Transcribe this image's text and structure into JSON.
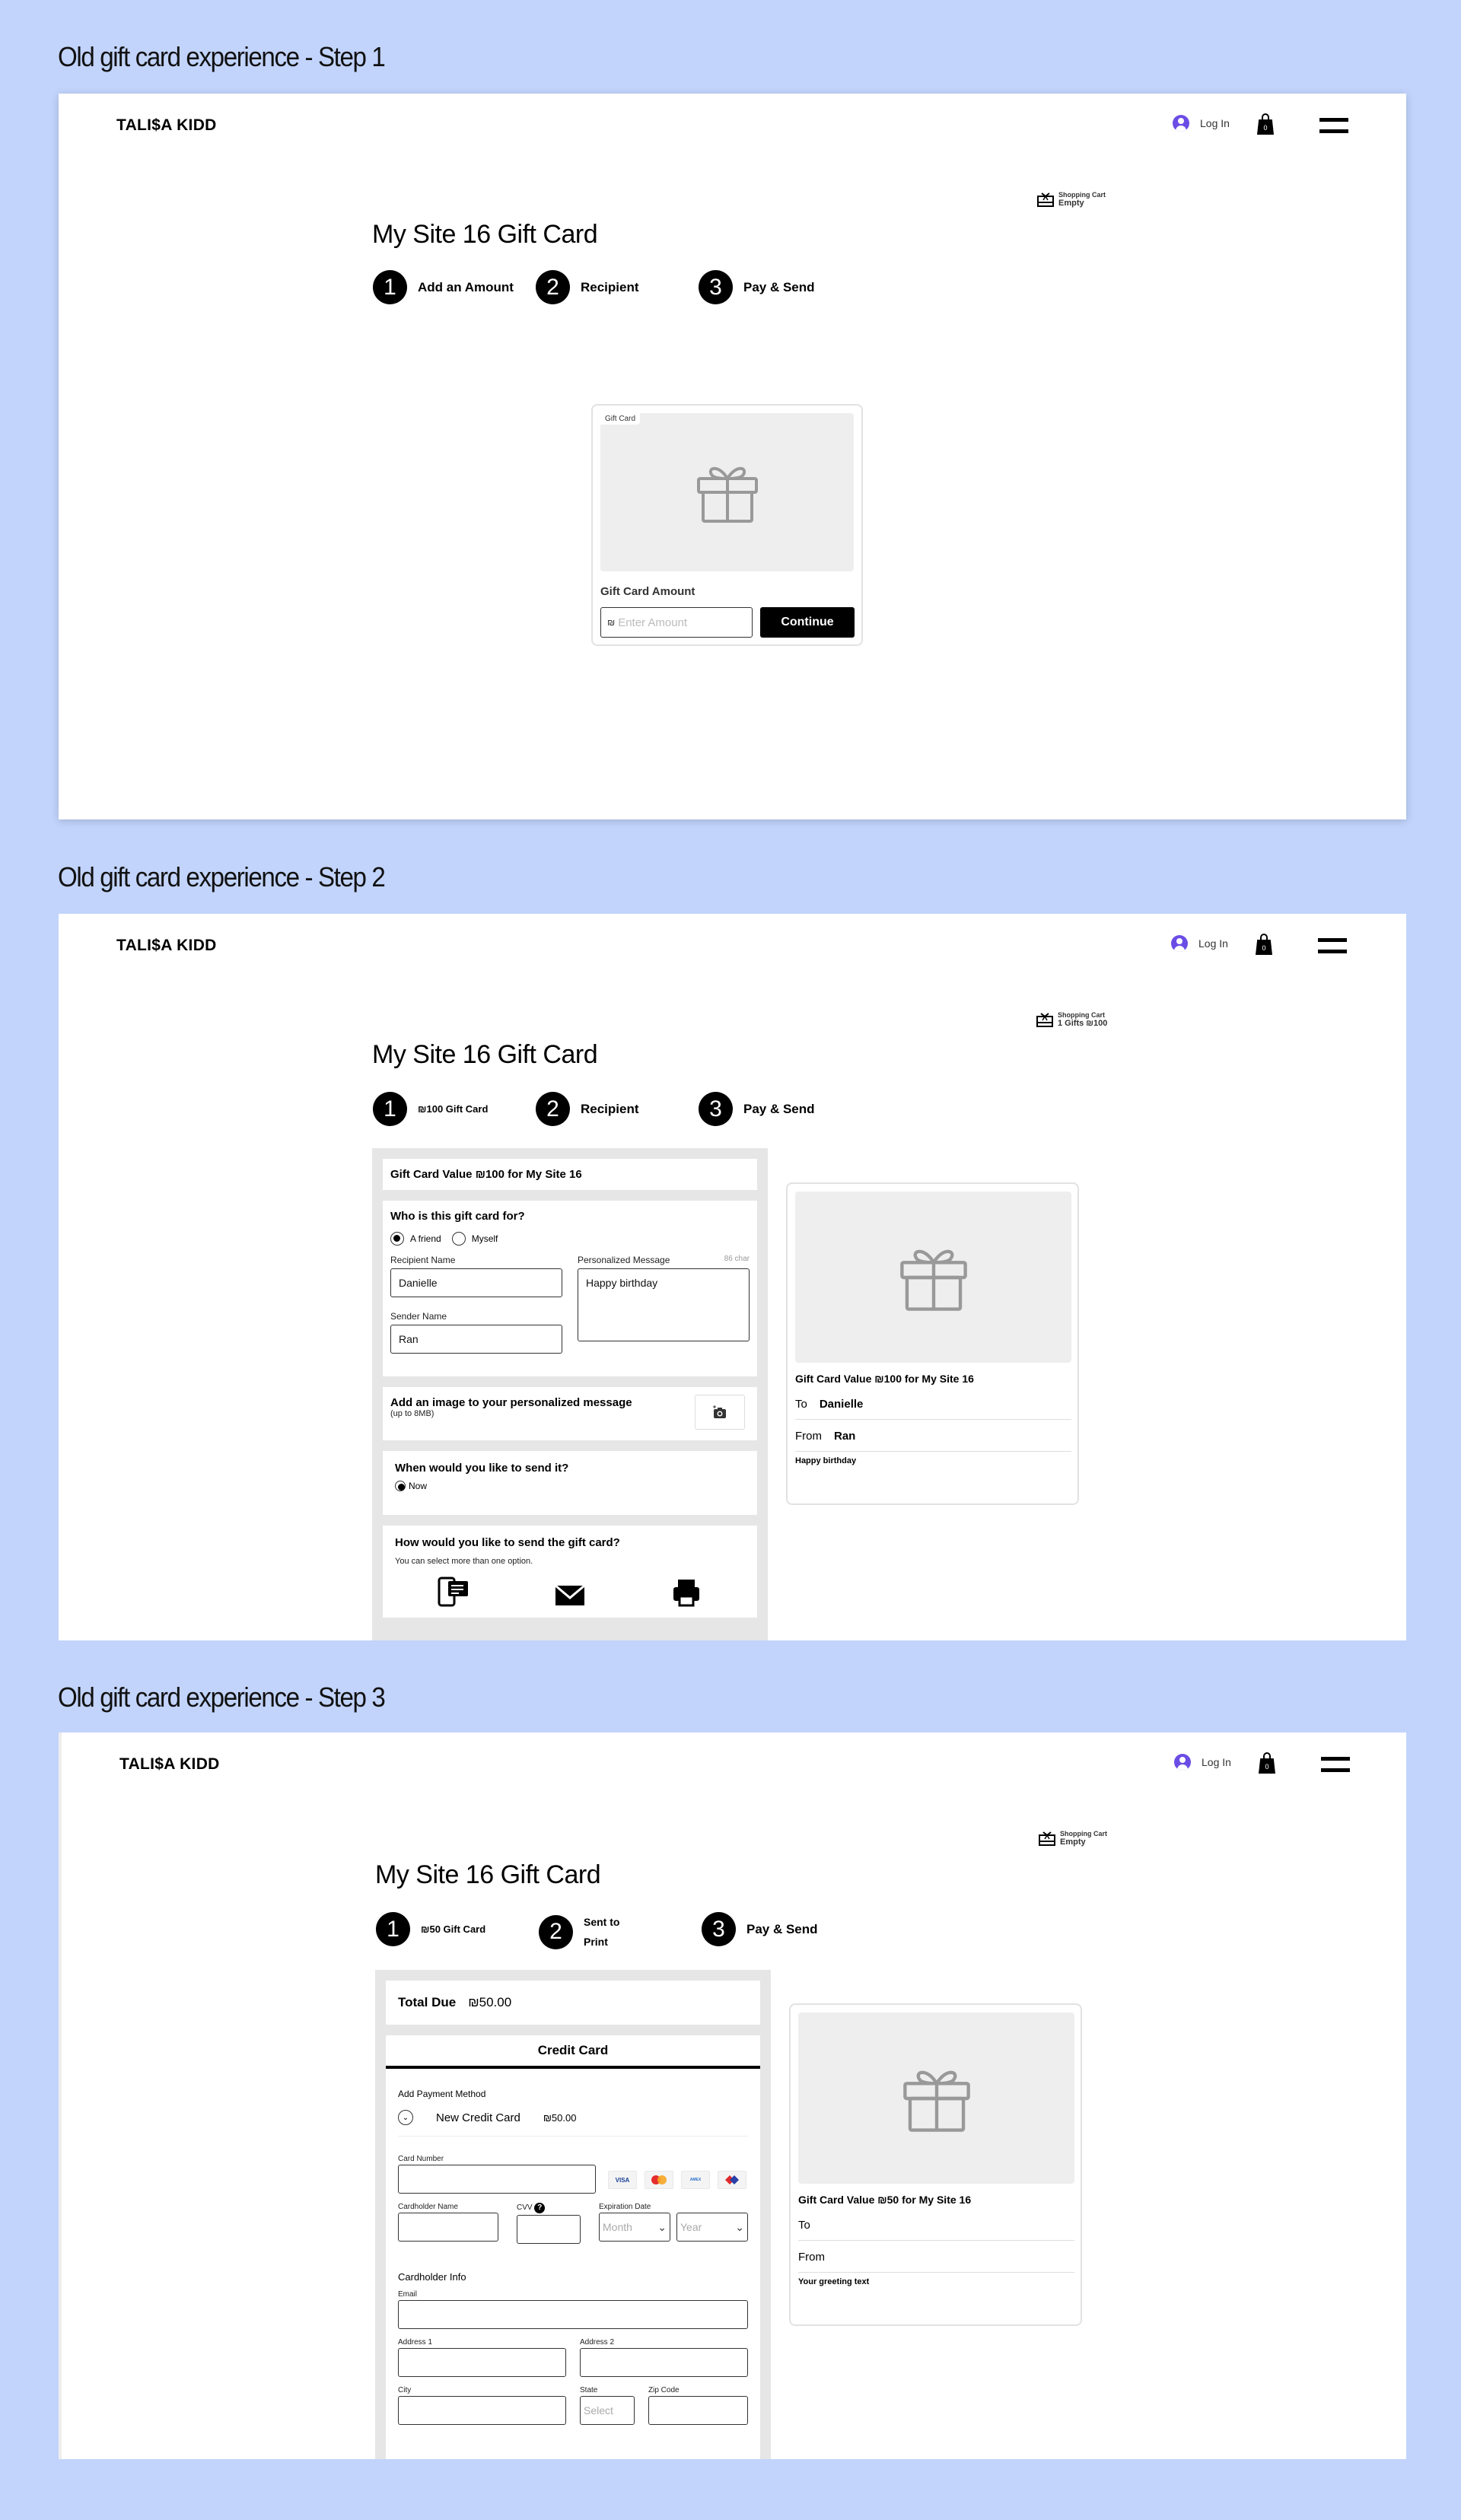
{
  "sections": [
    {
      "title": "Old gift card experience - Step 1",
      "header": {
        "logo": "TALI$A KIDD",
        "login": "Log In",
        "cart_count": "0"
      },
      "mini_cart": {
        "label": "Shopping Cart",
        "status": "Empty"
      },
      "page_title": "My Site 16 Gift Card",
      "steps": [
        {
          "num": "1",
          "label": "Add an Amount"
        },
        {
          "num": "2",
          "label": "Recipient"
        },
        {
          "num": "3",
          "label": "Pay & Send"
        }
      ],
      "gift_card": {
        "tag": "Gift Card",
        "amount_label": "Gift Card Amount",
        "currency": "₪",
        "amount_placeholder": "Enter Amount",
        "continue_label": "Continue"
      }
    },
    {
      "title": "Old gift card experience - Step 2",
      "header": {
        "logo": "TALI$A KIDD",
        "login": "Log In",
        "cart_count": "0"
      },
      "mini_cart": {
        "label": "Shopping Cart",
        "status": "1 Gifts ₪100"
      },
      "page_title": "My Site 16 Gift Card",
      "steps": [
        {
          "num": "1",
          "label": "₪100 Gift Card"
        },
        {
          "num": "2",
          "label": "Recipient"
        },
        {
          "num": "3",
          "label": "Pay & Send"
        }
      ],
      "form": {
        "value_title": "Gift Card Value ₪100 for My Site 16",
        "who_title": "Who is this gift card for?",
        "radio_friend": "A friend",
        "radio_myself": "Myself",
        "recipient_label": "Recipient Name",
        "recipient_value": "Danielle",
        "sender_label": "Sender Name",
        "sender_value": "Ran",
        "message_label": "Personalized Message",
        "message_count": "86 char",
        "message_value": "Happy birthday",
        "image_title": "Add an image to your personalized message",
        "image_sub": "(up to 8MB)",
        "when_title": "When would you like to send it?",
        "when_now": "Now",
        "how_title": "How would you like to send the gift card?",
        "how_sub": "You can select more than one option."
      },
      "preview": {
        "title": "Gift Card Value ₪100 for My Site 16",
        "to_label": "To",
        "to_value": "Danielle",
        "from_label": "From",
        "from_value": "Ran",
        "message": "Happy birthday"
      }
    },
    {
      "title": "Old gift card experience - Step 3",
      "header": {
        "logo": "TALI$A KIDD",
        "login": "Log In",
        "cart_count": "0"
      },
      "mini_cart": {
        "label": "Shopping Cart",
        "status": "Empty"
      },
      "page_title": "My Site 16 Gift Card",
      "steps": [
        {
          "num": "1",
          "label": "₪50 Gift Card"
        },
        {
          "num": "2",
          "label": "Sent to Print"
        },
        {
          "num": "3",
          "label": "Pay & Send"
        }
      ],
      "payment": {
        "total_label": "Total Due",
        "total_value": "₪50.00",
        "tab": "Credit Card",
        "add_method": "Add Payment Method",
        "new_card": "New Credit Card",
        "new_card_amount": "₪50.00",
        "card_number": "Card Number",
        "card_logos": [
          "VISA",
          "MasterCard",
          "American Express",
          "Diners"
        ],
        "holder_name": "Cardholder Name",
        "cvv": "CVV",
        "expiration": "Expiration Date",
        "month_placeholder": "Month",
        "year_placeholder": "Year",
        "holder_info": "Cardholder Info",
        "email": "Email",
        "address1": "Address 1",
        "address2": "Address 2",
        "city": "City",
        "state": "State",
        "state_placeholder": "Select",
        "zip": "Zip Code"
      },
      "preview": {
        "title": "Gift Card Value ₪50 for My Site 16",
        "to_label": "To",
        "from_label": "From",
        "message": "Your greeting text"
      }
    }
  ]
}
